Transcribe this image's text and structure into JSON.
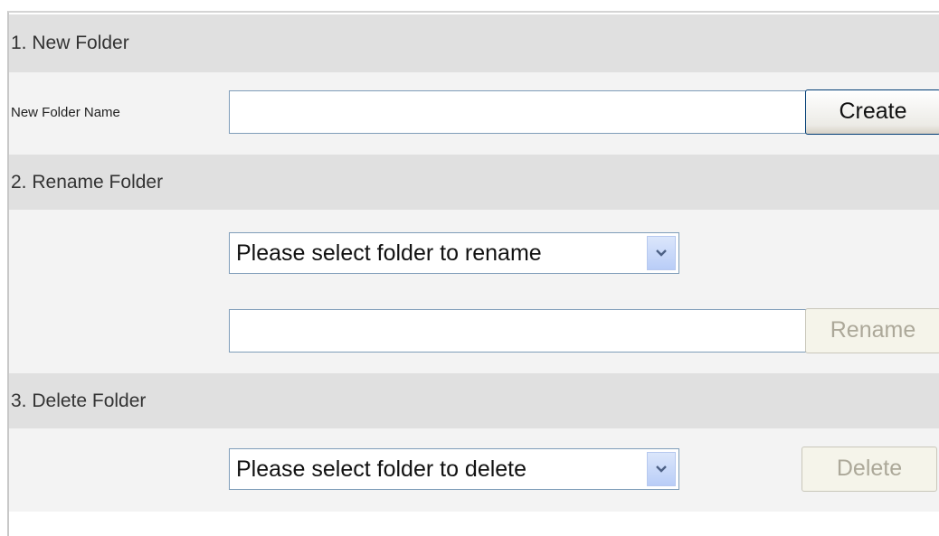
{
  "new_folder": {
    "header": "1. New Folder",
    "name_label": "New Folder Name",
    "name_value": "",
    "create_label": "Create"
  },
  "rename_folder": {
    "header": "2. Rename Folder",
    "select_value": "Please select folder to rename",
    "new_name_value": "",
    "rename_label": "Rename"
  },
  "delete_folder": {
    "header": "3. Delete Folder",
    "select_value": "Please select folder to delete",
    "delete_label": "Delete"
  },
  "icons": {
    "dropdown": "chevron-down-icon"
  },
  "colors": {
    "section_header_bg": "#e0e0e0",
    "row_bg": "#f3f3f3",
    "input_border": "#7f9db9",
    "disabled_text": "#aca899"
  }
}
